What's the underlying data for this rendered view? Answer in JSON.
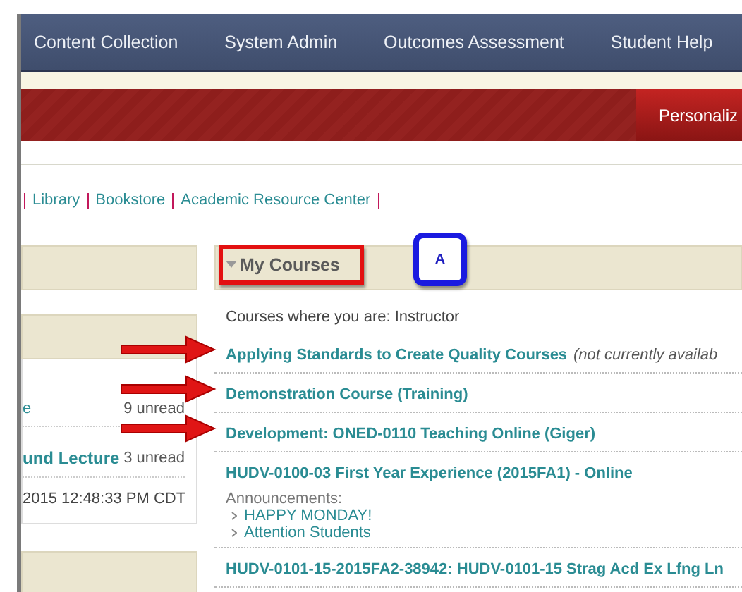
{
  "nav": {
    "tabs": [
      "Content Collection",
      "System Admin",
      "Outcomes Assessment",
      "Student Help"
    ]
  },
  "banner": {
    "button": "Personaliz"
  },
  "quick_links": [
    "Library",
    "Bookstore",
    "Academic Resource Center"
  ],
  "left_panel": {
    "items": [
      {
        "title": "e",
        "count": "9 unread",
        "bold": false
      },
      {
        "title": "und Lecture",
        "count": "3 unread",
        "bold": true
      }
    ],
    "timestamp": "2015 12:48:33 PM CDT"
  },
  "my_courses": {
    "title": "My Courses",
    "annotation_badge": "A",
    "role_line": "Courses where you are: Instructor",
    "courses": [
      {
        "title": "Applying Standards to Create Quality Courses",
        "note": "(not currently availab",
        "highlighted": true
      },
      {
        "title": "Demonstration Course (Training)",
        "highlighted": true
      },
      {
        "title": "Development: ONED-0110 Teaching Online (Giger)",
        "highlighted": true
      },
      {
        "title": "HUDV-0100-03 First Year Experience (2015FA1) - Online",
        "highlighted": false,
        "announcements_label": "Announcements:",
        "announcements": [
          "HAPPY MONDAY!",
          "Attention Students"
        ]
      },
      {
        "title": "HUDV-0101-15-2015FA2-38942: HUDV-0101-15 Strag Acd Ex Lfng Ln",
        "highlighted": false
      }
    ]
  }
}
